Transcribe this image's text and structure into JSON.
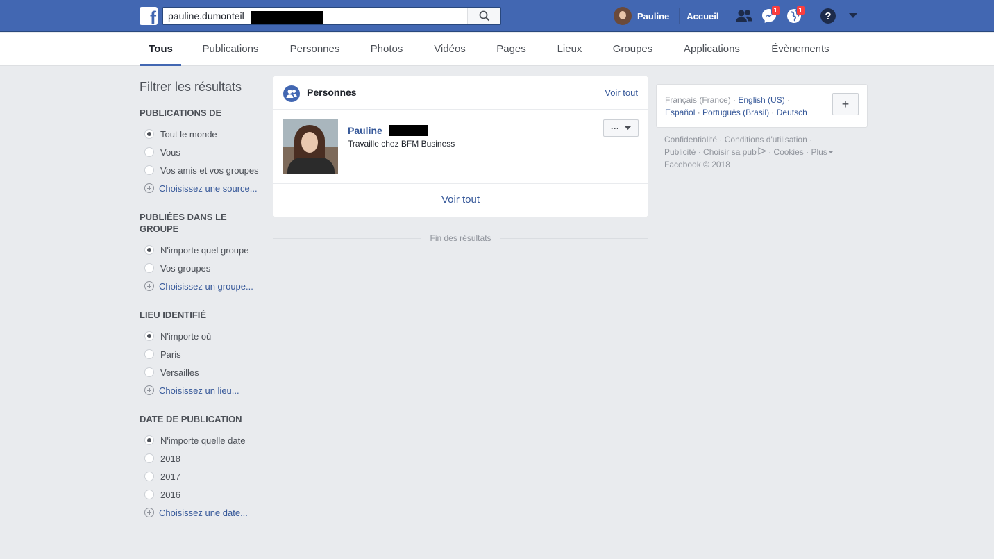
{
  "header": {
    "search_value": "pauline.dumonteil",
    "user_name": "Pauline",
    "home_label": "Accueil",
    "messages_badge": "1",
    "notifications_badge": "1",
    "colors": {
      "bar": "#4267b2",
      "badge": "#fa3e3e"
    }
  },
  "tabs": [
    {
      "label": "Tous",
      "active": true
    },
    {
      "label": "Publications"
    },
    {
      "label": "Personnes"
    },
    {
      "label": "Photos"
    },
    {
      "label": "Vidéos"
    },
    {
      "label": "Pages"
    },
    {
      "label": "Lieux"
    },
    {
      "label": "Groupes"
    },
    {
      "label": "Applications"
    },
    {
      "label": "Évènements"
    }
  ],
  "filters": {
    "title": "Filtrer les résultats",
    "sections": [
      {
        "title": "PUBLICATIONS DE",
        "options": [
          "Tout le monde",
          "Vous",
          "Vos amis et vos groupes"
        ],
        "selected": 0,
        "add": "Choisissez une source..."
      },
      {
        "title": "PUBLIÉES DANS LE GROUPE",
        "options": [
          "N'importe quel groupe",
          "Vos groupes"
        ],
        "selected": 0,
        "add": "Choisissez un groupe..."
      },
      {
        "title": "LIEU IDENTIFIÉ",
        "options": [
          "N'importe où",
          "Paris",
          "Versailles"
        ],
        "selected": 0,
        "add": "Choisissez un lieu..."
      },
      {
        "title": "DATE DE PUBLICATION",
        "options": [
          "N'importe quelle date",
          "2018",
          "2017",
          "2016"
        ],
        "selected": 0,
        "add": "Choisissez une date..."
      }
    ]
  },
  "people_card": {
    "title": "Personnes",
    "see_all_top": "Voir tout",
    "result": {
      "name": "Pauline",
      "subtitle": "Travaille chez BFM Business",
      "more_label": "···"
    },
    "see_all_bottom": "Voir tout"
  },
  "end_of_results": "Fin des résultats",
  "languages": {
    "current": "Français (France)",
    "links": [
      "English (US)",
      "Español",
      "Português (Brasil)",
      "Deutsch"
    ],
    "add_label": "+"
  },
  "footer": {
    "links": [
      "Confidentialité",
      "Conditions d'utilisation",
      "Publicité",
      "Choisir sa pub",
      "Cookies",
      "Plus"
    ],
    "copyright": "Facebook © 2018"
  }
}
